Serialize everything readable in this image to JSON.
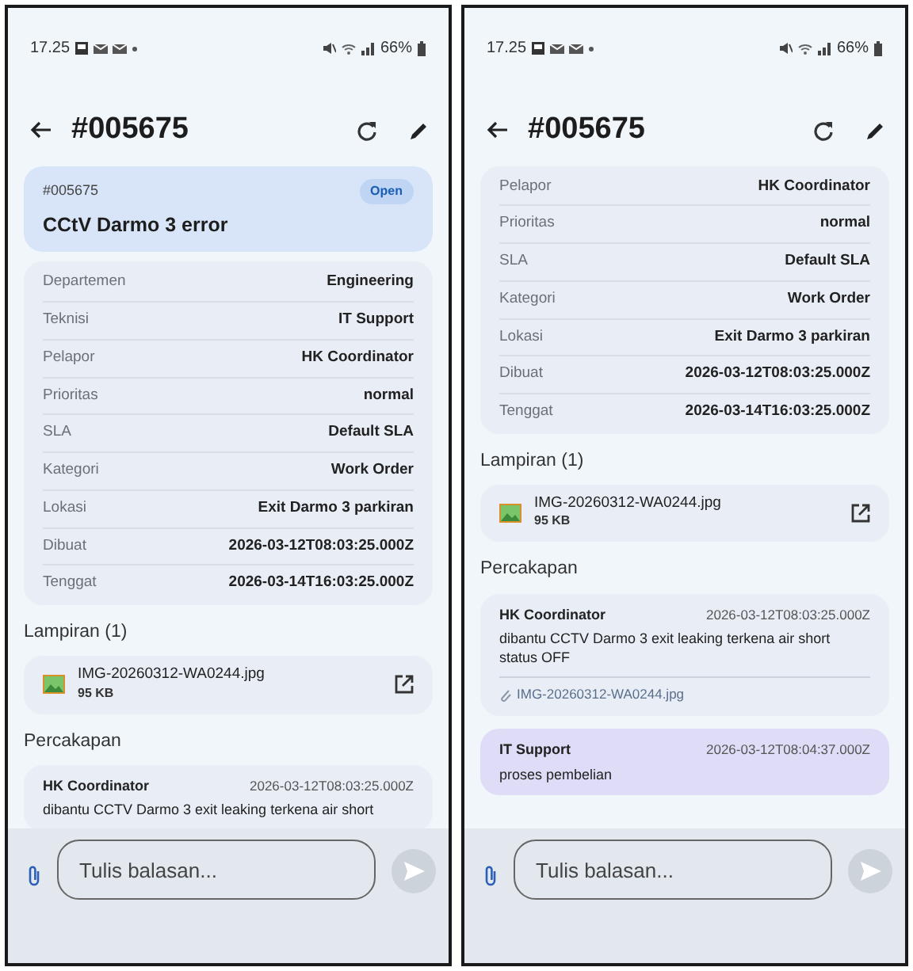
{
  "screens": [
    {
      "status_bar": {
        "time": "17.25",
        "battery": "66%"
      },
      "header": {
        "title": "#005675"
      },
      "ticket": {
        "number": "#005675",
        "status": "Open",
        "subject": "CCtV Darmo 3 error"
      },
      "details": [
        {
          "label": "Departemen",
          "value": "Engineering"
        },
        {
          "label": "Teknisi",
          "value": "IT Support"
        },
        {
          "label": "Pelapor",
          "value": "HK Coordinator"
        },
        {
          "label": "Prioritas",
          "value": "normal"
        },
        {
          "label": "SLA",
          "value": "Default SLA"
        },
        {
          "label": "Kategori",
          "value": "Work Order"
        },
        {
          "label": "Lokasi",
          "value": "Exit Darmo 3 parkiran"
        },
        {
          "label": "Dibuat",
          "value": "2026-03-12T08:03:25.000Z"
        },
        {
          "label": "Tenggat",
          "value": "2026-03-14T16:03:25.000Z"
        }
      ],
      "attachments": {
        "heading": "Lampiran (1)",
        "files": [
          {
            "name": "IMG-20260312-WA0244.jpg",
            "size": "95 KB"
          }
        ]
      },
      "conversation": {
        "heading": "Percakapan",
        "messages": [
          {
            "kind": "incoming",
            "author": "HK Coordinator",
            "time": "2026-03-12T08:03:25.000Z",
            "text": "dibantu CCTV Darmo 3 exit leaking terkena air short"
          }
        ]
      },
      "composer": {
        "placeholder": "Tulis balasan..."
      }
    },
    {
      "status_bar": {
        "time": "17.25",
        "battery": "66%"
      },
      "header": {
        "title": "#005675"
      },
      "details": [
        {
          "label": "Pelapor",
          "value": "HK Coordinator"
        },
        {
          "label": "Prioritas",
          "value": "normal"
        },
        {
          "label": "SLA",
          "value": "Default SLA"
        },
        {
          "label": "Kategori",
          "value": "Work Order"
        },
        {
          "label": "Lokasi",
          "value": "Exit Darmo 3 parkiran"
        },
        {
          "label": "Dibuat",
          "value": "2026-03-12T08:03:25.000Z"
        },
        {
          "label": "Tenggat",
          "value": "2026-03-14T16:03:25.000Z"
        }
      ],
      "attachments": {
        "heading": "Lampiran (1)",
        "files": [
          {
            "name": "IMG-20260312-WA0244.jpg",
            "size": "95 KB"
          }
        ]
      },
      "conversation": {
        "heading": "Percakapan",
        "messages": [
          {
            "kind": "incoming",
            "author": "HK Coordinator",
            "time": "2026-03-12T08:03:25.000Z",
            "text": "dibantu CCTV Darmo 3 exit leaking terkena air short status OFF",
            "attachment": "IMG-20260312-WA0244.jpg"
          },
          {
            "kind": "outgoing",
            "author": "IT Support",
            "time": "2026-03-12T08:04:37.000Z",
            "text": "proses pembelian"
          }
        ]
      },
      "composer": {
        "placeholder": "Tulis balasan..."
      }
    }
  ]
}
